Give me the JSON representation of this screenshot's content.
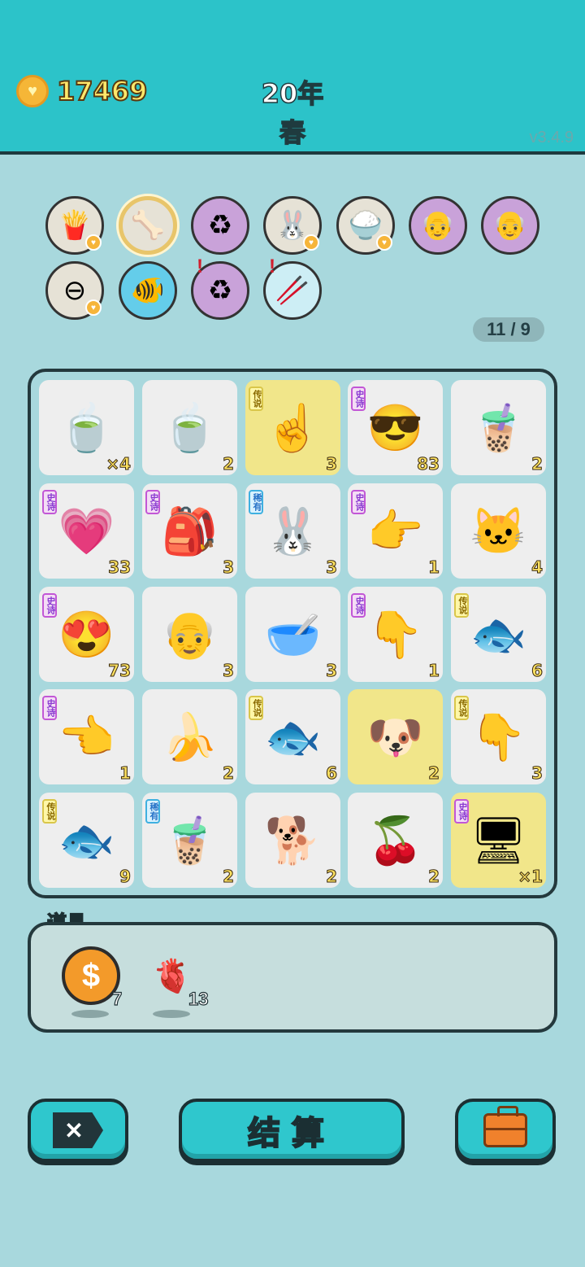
{
  "header": {
    "coins": "17469",
    "year": "20年",
    "season": "春",
    "version": "v3.4.9"
  },
  "modifiers": [
    {
      "name": "fries",
      "icon": "🍟",
      "bg": "#e6e2d6",
      "heart": true
    },
    {
      "name": "pet-bowl",
      "icon": "🦴",
      "bg": "#e6e2d6",
      "gold": true
    },
    {
      "name": "recycle",
      "icon": "♻",
      "bg": "#c9a2d9"
    },
    {
      "name": "rabbit",
      "icon": "🐰",
      "bg": "#e6e2d6",
      "heart": true
    },
    {
      "name": "rice-bowl",
      "icon": "🍚",
      "bg": "#e6e2d6",
      "heart": true
    },
    {
      "name": "multiplier-grandpa",
      "icon": "👴",
      "bg": "#c9a2d9"
    },
    {
      "name": "multiplier-grandpa-2",
      "icon": "👴",
      "bg": "#c9a2d9"
    },
    {
      "name": "minus",
      "icon": "⊖",
      "bg": "#e6e2d6",
      "heart": true
    },
    {
      "name": "fish-tank",
      "icon": "🐠",
      "bg": "#64cdea"
    },
    {
      "name": "recycle-2",
      "icon": "♻",
      "bg": "#c9a2d9",
      "alert": true
    },
    {
      "name": "chopsticks",
      "icon": "🥢",
      "bg": "#cdeef5",
      "alert": true
    }
  ],
  "counter": "11 / 9",
  "rarity_labels": {
    "epic": "史诗",
    "legend": "传说",
    "rare": "稀有"
  },
  "cells": [
    {
      "name": "tea-bowl",
      "icon": "🍵",
      "qty": "×4"
    },
    {
      "name": "tea-bag",
      "icon": "🍵",
      "qty": "2"
    },
    {
      "name": "golden-finger",
      "icon": "☝",
      "qty": "3",
      "rarity": "legend",
      "gold": true
    },
    {
      "name": "cool-guy",
      "icon": "😎",
      "qty": "83",
      "rarity": "epic"
    },
    {
      "name": "bubble-tea-small",
      "icon": "🧋",
      "qty": "2"
    },
    {
      "name": "heart-lady",
      "icon": "💗",
      "qty": "33",
      "rarity": "epic"
    },
    {
      "name": "rabbit-bag",
      "icon": "🎒",
      "qty": "3",
      "rarity": "epic"
    },
    {
      "name": "rabbit",
      "icon": "🐰",
      "qty": "3",
      "rarity": "rare"
    },
    {
      "name": "pointing-hand",
      "icon": "👉",
      "qty": "1",
      "rarity": "epic"
    },
    {
      "name": "cat",
      "icon": "🐱",
      "qty": "4"
    },
    {
      "name": "love-guy",
      "icon": "😍",
      "qty": "73",
      "rarity": "epic"
    },
    {
      "name": "grandpa",
      "icon": "👴",
      "qty": "3"
    },
    {
      "name": "empty-bowl",
      "icon": "🥣",
      "qty": "3"
    },
    {
      "name": "down-hand",
      "icon": "👇",
      "qty": "1",
      "rarity": "epic"
    },
    {
      "name": "koi-fish",
      "icon": "🐟",
      "qty": "6",
      "rarity": "legend"
    },
    {
      "name": "diagonal-hand",
      "icon": "👈",
      "qty": "1",
      "rarity": "epic"
    },
    {
      "name": "banana",
      "icon": "🍌",
      "qty": "2"
    },
    {
      "name": "koi-fish-2",
      "icon": "🐟",
      "qty": "6",
      "rarity": "legend"
    },
    {
      "name": "dog-gold",
      "icon": "🐶",
      "qty": "2",
      "gold": true
    },
    {
      "name": "golden-down-hand",
      "icon": "👇",
      "qty": "3",
      "rarity": "legend"
    },
    {
      "name": "koi-fish-3",
      "icon": "🐟",
      "qty": "9",
      "rarity": "legend"
    },
    {
      "name": "bubble-tea",
      "icon": "🧋",
      "qty": "2",
      "rarity": "rare"
    },
    {
      "name": "husky",
      "icon": "🐕",
      "qty": "2"
    },
    {
      "name": "cherries",
      "icon": "🍒",
      "qty": "2"
    },
    {
      "name": "gpu-card",
      "icon": "🖥",
      "qty": "×1",
      "rarity": "epic",
      "gold": true
    }
  ],
  "props": {
    "label": "道具",
    "coin": {
      "qty": "7",
      "icon": "$"
    },
    "liver": {
      "qty": "13",
      "icon": "🫀"
    }
  },
  "buttons": {
    "close_icon": "✕",
    "settle": "结算"
  },
  "colors": {
    "background": "#a8d8dd",
    "header": "#2cc3c9",
    "button": "#2fc7cd",
    "coin_text": "#ffe86b"
  }
}
